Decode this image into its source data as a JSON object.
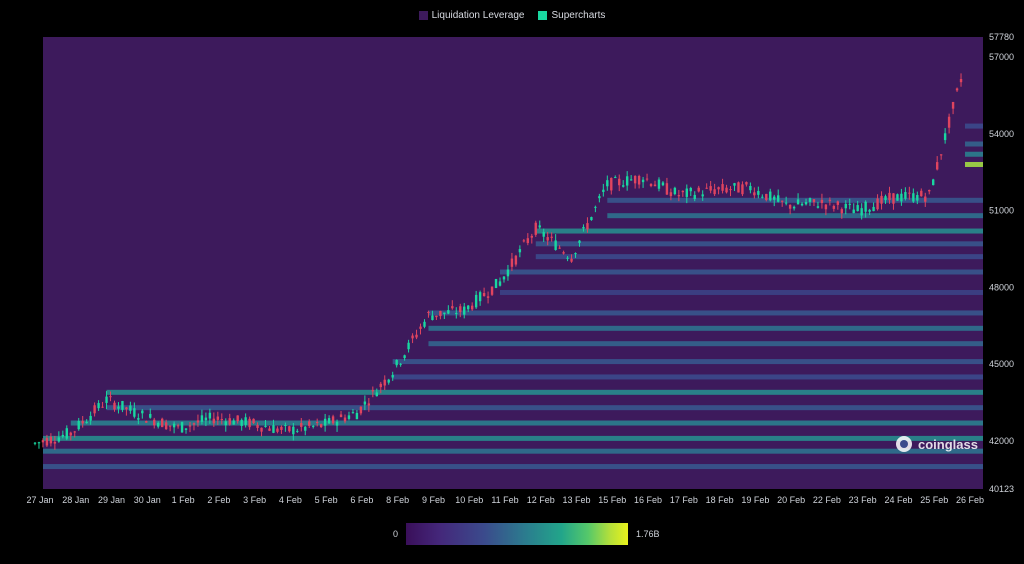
{
  "legend": {
    "items": [
      {
        "label": "Liquidation Leverage",
        "color": "#3d1a5c"
      },
      {
        "label": "Supercharts",
        "color": "#19d7a0"
      }
    ]
  },
  "colorbar": {
    "min_label": "0",
    "max_label": "1.76B"
  },
  "watermark": {
    "text": "coinglass"
  },
  "chart_data": {
    "type": "heatmap",
    "title": "",
    "xlabel": "",
    "ylabel": "",
    "ylim": [
      40123,
      57780
    ],
    "x_tick_labels": [
      "27 Jan",
      "28 Jan",
      "29 Jan",
      "30 Jan",
      "1 Feb",
      "2 Feb",
      "3 Feb",
      "4 Feb",
      "5 Feb",
      "6 Feb",
      "8 Feb",
      "9 Feb",
      "10 Feb",
      "11 Feb",
      "12 Feb",
      "13 Feb",
      "15 Feb",
      "16 Feb",
      "17 Feb",
      "18 Feb",
      "19 Feb",
      "20 Feb",
      "22 Feb",
      "23 Feb",
      "24 Feb",
      "25 Feb",
      "26 Feb"
    ],
    "y_tick_labels": [
      "57780",
      "57000",
      "54000",
      "51000",
      "48000",
      "45000",
      "42000",
      "40123"
    ],
    "y_ticks": [
      57780,
      57000,
      54000,
      51000,
      48000,
      45000,
      42000,
      40123
    ],
    "price_series": {
      "name": "Supercharts",
      "x": [
        "27 Jan",
        "28 Jan",
        "29 Jan",
        "30 Jan",
        "1 Feb",
        "2 Feb",
        "3 Feb",
        "4 Feb",
        "5 Feb",
        "6 Feb",
        "8 Feb",
        "9 Feb",
        "10 Feb",
        "11 Feb",
        "12 Feb",
        "13 Feb",
        "15 Feb",
        "16 Feb",
        "17 Feb",
        "18 Feb",
        "19 Feb",
        "20 Feb",
        "22 Feb",
        "23 Feb",
        "24 Feb",
        "25 Feb",
        "26 Feb"
      ],
      "close": [
        41900,
        42300,
        43600,
        43000,
        42500,
        42900,
        42700,
        42400,
        42600,
        43100,
        44700,
        46900,
        47100,
        48200,
        50300,
        49200,
        52000,
        52300,
        51600,
        51800,
        51900,
        51200,
        51300,
        51000,
        51500,
        51600,
        56700
      ]
    },
    "liquidation_bands": [
      {
        "price": 54300,
        "intensity": 0.35
      },
      {
        "price": 53600,
        "intensity": 0.45
      },
      {
        "price": 53200,
        "intensity": 0.55
      },
      {
        "price": 52800,
        "intensity": 0.9
      },
      {
        "price": 51400,
        "intensity": 0.4
      },
      {
        "price": 50800,
        "intensity": 0.5
      },
      {
        "price": 50200,
        "intensity": 0.6
      },
      {
        "price": 49700,
        "intensity": 0.4
      },
      {
        "price": 49200,
        "intensity": 0.35
      },
      {
        "price": 48600,
        "intensity": 0.4
      },
      {
        "price": 47800,
        "intensity": 0.3
      },
      {
        "price": 47000,
        "intensity": 0.4
      },
      {
        "price": 46400,
        "intensity": 0.5
      },
      {
        "price": 45800,
        "intensity": 0.45
      },
      {
        "price": 45100,
        "intensity": 0.4
      },
      {
        "price": 44500,
        "intensity": 0.35
      },
      {
        "price": 43900,
        "intensity": 0.6
      },
      {
        "price": 43300,
        "intensity": 0.4
      },
      {
        "price": 42700,
        "intensity": 0.55
      },
      {
        "price": 42100,
        "intensity": 0.6
      },
      {
        "price": 41600,
        "intensity": 0.5
      },
      {
        "price": 41000,
        "intensity": 0.4
      }
    ]
  }
}
